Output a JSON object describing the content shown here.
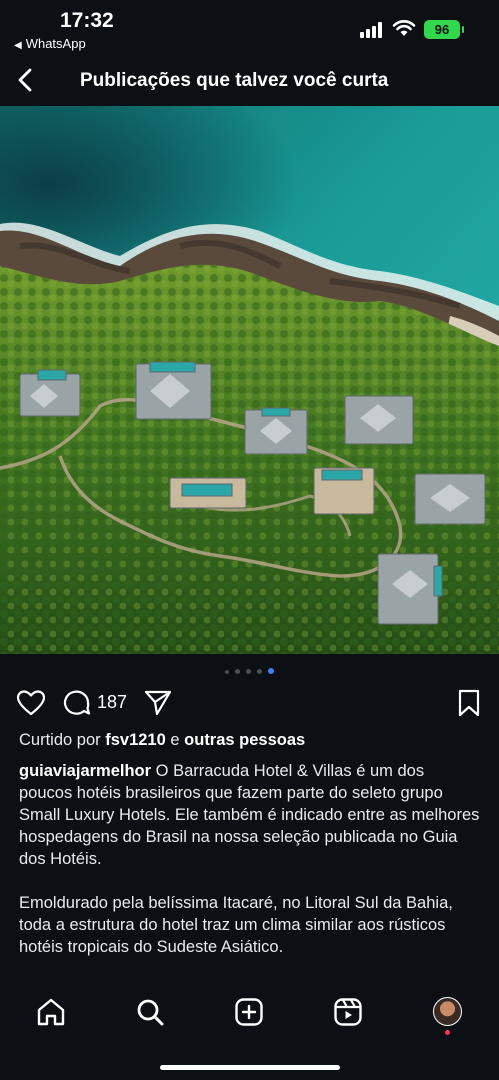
{
  "status_bar": {
    "time": "17:32",
    "back_app": "WhatsApp",
    "battery": "96"
  },
  "header": {
    "title": "Publicações que talvez você curta",
    "back_icon": "chevron-left-icon"
  },
  "carousel": {
    "total": 5,
    "active_index": 4
  },
  "actions": {
    "comment_count": "187",
    "icons": [
      "heart-icon",
      "comment-icon",
      "share-icon",
      "bookmark-icon"
    ]
  },
  "likes": {
    "prefix": "Curtido por",
    "user": "fsv1210",
    "joiner": "e",
    "others": "outras pessoas"
  },
  "caption": {
    "username": "guiaviajarmelhor",
    "paragraph1": "O Barracuda Hotel & Villas é um dos poucos hotéis brasileiros que fazem parte do seleto grupo Small Luxury Hotels. Ele também é  indicado entre as melhores hospedagens do Brasil na nossa seleção publicada no Guia dos Hotéis.",
    "paragraph2": "Emoldurado pela belíssima Itacaré, no Litoral Sul da Bahia, toda a estrutura do hotel traz um clima similar aos rústicos hotéis tropicais do Sudeste Asiático."
  },
  "bottom_nav": {
    "items": [
      "home-icon",
      "search-icon",
      "create-icon",
      "reels-icon",
      "profile-avatar"
    ]
  },
  "colors": {
    "background": "#0c0f14",
    "accent": "#3b82f6",
    "battery": "#32d74b"
  }
}
